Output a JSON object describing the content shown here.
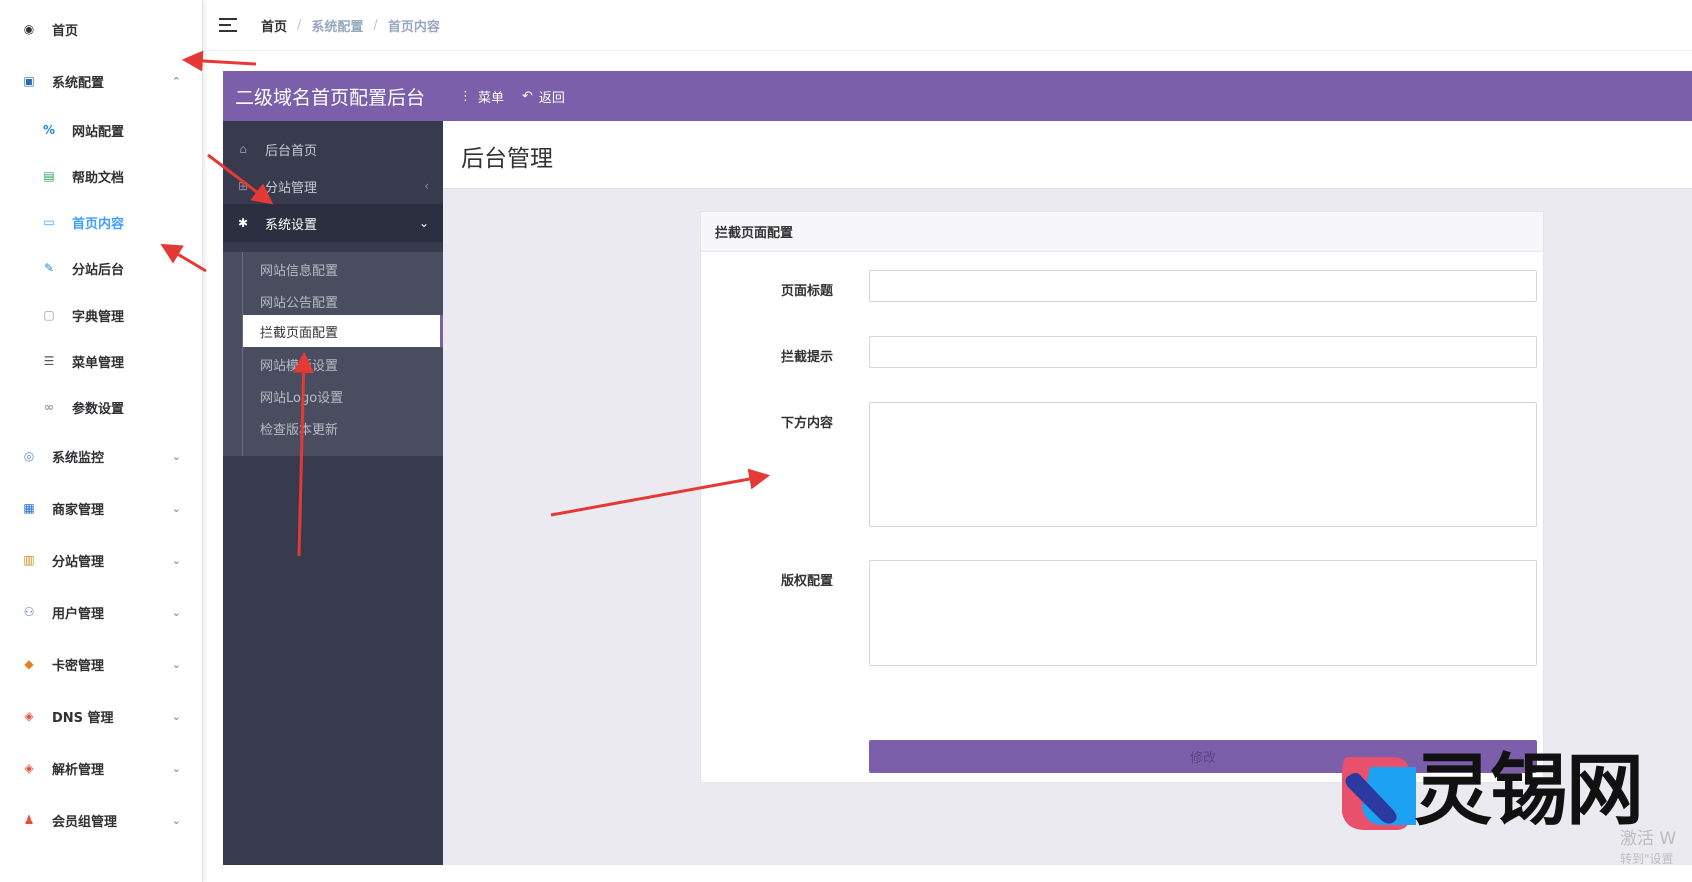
{
  "outer_sidebar": {
    "items": [
      {
        "label": "首页",
        "icon": "dashboard-icon",
        "level": "top"
      },
      {
        "label": "系统配置",
        "icon": "system-config-icon",
        "level": "top",
        "caret": "^"
      },
      {
        "label": "网站配置",
        "icon": "percent-icon",
        "level": "sub"
      },
      {
        "label": "帮助文档",
        "icon": "clipboard-icon",
        "level": "sub"
      },
      {
        "label": "首页内容",
        "icon": "monitor-icon",
        "level": "sub",
        "active": true
      },
      {
        "label": "分站后台",
        "icon": "edit-doc-icon",
        "level": "sub"
      },
      {
        "label": "字典管理",
        "icon": "dictionary-icon",
        "level": "sub"
      },
      {
        "label": "菜单管理",
        "icon": "menu-list-icon",
        "level": "sub"
      },
      {
        "label": "参数设置",
        "icon": "link-icon",
        "level": "sub"
      },
      {
        "label": "系统监控",
        "icon": "monitor-camera-icon",
        "level": "top",
        "caret": "v"
      },
      {
        "label": "商家管理",
        "icon": "store-icon",
        "level": "top",
        "caret": "v"
      },
      {
        "label": "分站管理",
        "icon": "substation-icon",
        "level": "top",
        "caret": "v"
      },
      {
        "label": "用户管理",
        "icon": "users-icon",
        "level": "top",
        "caret": "v"
      },
      {
        "label": "卡密管理",
        "icon": "box-icon",
        "level": "top",
        "caret": "v"
      },
      {
        "label": "DNS 管理",
        "icon": "dns-icon",
        "level": "top",
        "caret": "v"
      },
      {
        "label": "解析管理",
        "icon": "dns-resolve-icon",
        "level": "top",
        "caret": "v"
      },
      {
        "label": "会员组管理",
        "icon": "member-group-icon",
        "level": "top",
        "caret": "v"
      }
    ]
  },
  "breadcrumb": [
    "首页",
    "系统配置",
    "首页内容"
  ],
  "panel": {
    "title": "二级域名首页配置后台",
    "menu_label": "菜单",
    "back_label": "返回",
    "sidebar": [
      {
        "label": "后台首页",
        "icon": "home-icon"
      },
      {
        "label": "分站管理",
        "icon": "sitemap-icon",
        "chevron": "‹"
      },
      {
        "label": "系统设置",
        "icon": "gear-icon",
        "chevron": "⌄",
        "open": true
      }
    ],
    "sub_items": [
      {
        "label": "网站信息配置"
      },
      {
        "label": "网站公告配置"
      },
      {
        "label": "拦截页面配置",
        "active": true
      },
      {
        "label": "网站模板设置"
      },
      {
        "label": "网站Logo设置"
      },
      {
        "label": "检查版本更新"
      }
    ],
    "content_title": "后台管理",
    "card": {
      "title": "拦截页面配置",
      "fields": [
        {
          "label": "页面标题",
          "value": ""
        },
        {
          "label": "拦截提示",
          "value": ""
        },
        {
          "label": "下方内容",
          "value": ""
        },
        {
          "label": "版权配置",
          "value": ""
        }
      ],
      "submit_label": "修改"
    }
  },
  "watermark": {
    "logo_text": "灵锡网",
    "activate_title": "激活 W",
    "activate_sub": "转到\"设置"
  },
  "colors": {
    "accent_purple": "#7b5fab",
    "sidebar_dark": "#383b4e",
    "active_blue": "#409eff",
    "arrow_red": "#e53935"
  }
}
